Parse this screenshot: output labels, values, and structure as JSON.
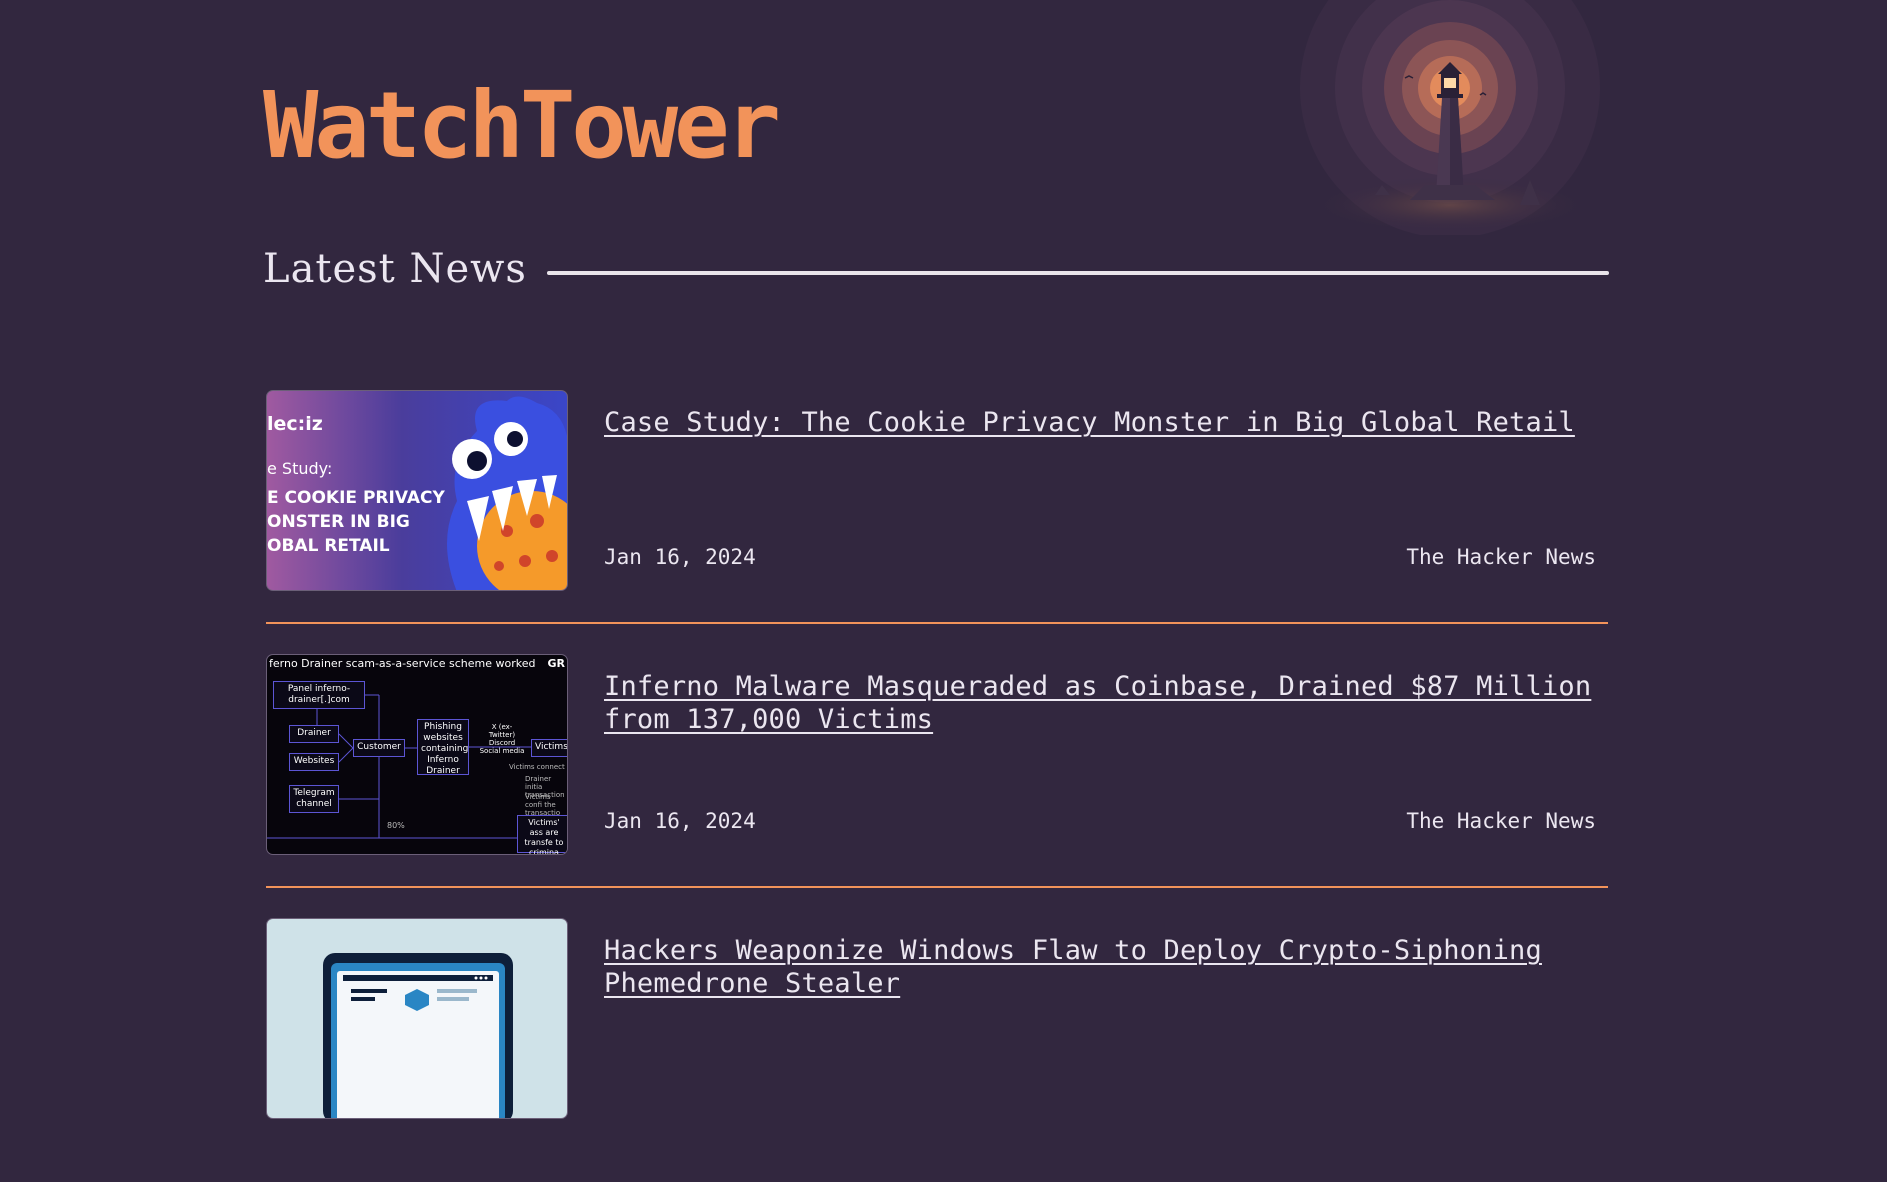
{
  "site": {
    "title": "WatchTower"
  },
  "section": {
    "title": "Latest News"
  },
  "news": [
    {
      "headline": "Case Study: The Cookie Privacy Monster in Big Global Retail",
      "date": "Jan 16, 2024",
      "source": "The Hacker News",
      "thumb": {
        "brand": "lec:iz",
        "sub": "e Study:",
        "big": "E COOKIE PRIVACY ONSTER IN BIG OBAL RETAIL"
      }
    },
    {
      "headline": "Inferno Malware Masqueraded as Coinbase, Drained $87 Million from 137,000 Victims",
      "date": "Jan 16, 2024",
      "source": "The Hacker News",
      "thumb": {
        "caption": "ferno Drainer scam-as-a-service scheme worked",
        "logo": "GR",
        "panel": "Panel inferno-drainer[.]com",
        "drainer": "Drainer",
        "websites": "Websites",
        "telegram": "Telegram channel",
        "customer": "Customer",
        "phishing": "Phishing websites containing Inferno Drainer",
        "social": "X (ex-Twitter) Discord Social media",
        "victims": "Victims",
        "connect": "Victims connect th",
        "drainer_init": "Drainer initia transaction",
        "victims_conf": "Victims confi the transactio",
        "victims_assets": "Victims' ass are transfe to crimina",
        "percent": "80%"
      }
    },
    {
      "headline": "Hackers Weaponize Windows Flaw to Deploy Crypto-Siphoning Phemedrone Stealer",
      "date": "",
      "source": ""
    }
  ],
  "colors": {
    "background": "#32273f",
    "accent": "#f2935a",
    "text": "#ebe6f0"
  }
}
